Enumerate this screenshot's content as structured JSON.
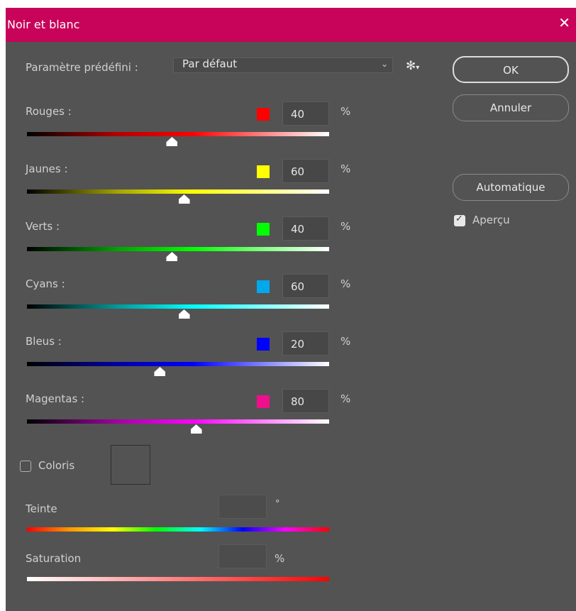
{
  "window": {
    "title": "Noir et blanc"
  },
  "preset": {
    "label": "Paramètre prédéfini :",
    "value": "Par défaut"
  },
  "buttons": {
    "ok": "OK",
    "cancel": "Annuler",
    "auto": "Automatique"
  },
  "preview": {
    "label": "Aperçu",
    "checked": true
  },
  "pct_symbol": "%",
  "channels": [
    {
      "label": "Rouges :",
      "value": "40",
      "level": 40,
      "swatch": "#ff0000"
    },
    {
      "label": "Jaunes :",
      "value": "60",
      "level": 60,
      "swatch": "#ffff00"
    },
    {
      "label": "Verts :",
      "value": "40",
      "level": 40,
      "swatch": "#00ff00"
    },
    {
      "label": "Cyans :",
      "value": "60",
      "level": 60,
      "swatch": "#00a8ec"
    },
    {
      "label": "Bleus :",
      "value": "20",
      "level": 20,
      "swatch": "#0000ff"
    },
    {
      "label": "Magentas :",
      "value": "80",
      "level": 80,
      "swatch": "#ee0f8c"
    }
  ],
  "tint": {
    "label": "Coloris",
    "checked": false,
    "hue_label": "Teinte",
    "hue_unit": "°",
    "saturation_label": "Saturation",
    "saturation_unit": "%"
  },
  "colors": {
    "titlebar": "#c8035a",
    "background": "#535353"
  }
}
